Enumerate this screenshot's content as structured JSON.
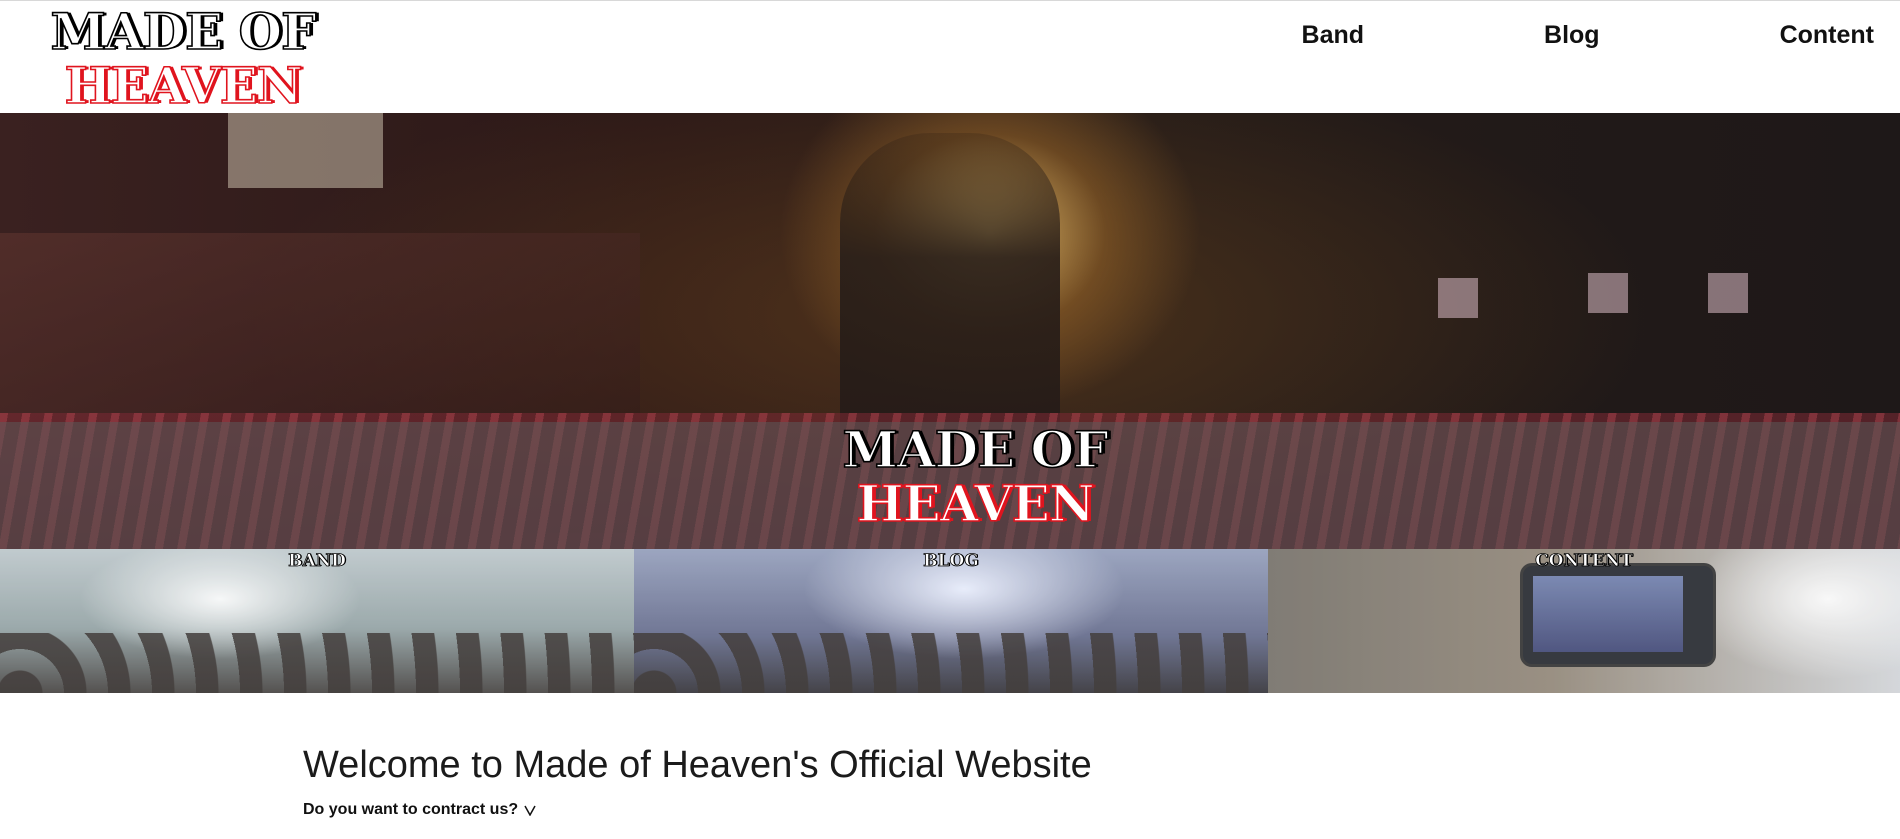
{
  "logo": {
    "line1": "MADE OF",
    "line2": "HEAVEN"
  },
  "nav": [
    {
      "label": "Band"
    },
    {
      "label": "Blog"
    },
    {
      "label": "Content"
    }
  ],
  "hero": {
    "logo_line1": "MADE OF",
    "logo_line2": "HEAVEN"
  },
  "tiles": [
    {
      "label": "BAND"
    },
    {
      "label": "BLOG"
    },
    {
      "label": "CONTENT"
    }
  ],
  "welcome": {
    "title": "Welcome to Made of Heaven's Official Website",
    "contract_prompt": "Do you want to contract us?"
  },
  "colors": {
    "logo_black": "#000000",
    "logo_red": "#e0141e",
    "text": "#111111"
  }
}
